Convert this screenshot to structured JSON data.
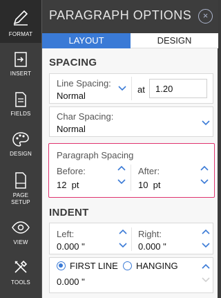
{
  "rail": {
    "items": [
      {
        "label": "FORMAT",
        "icon": "format-pen-icon",
        "active": true
      },
      {
        "label": "INSERT",
        "icon": "insert-icon"
      },
      {
        "label": "FIELDS",
        "icon": "fields-icon"
      },
      {
        "label": "DESIGN",
        "icon": "palette-icon"
      },
      {
        "label": "PAGE",
        "label2": "SETUP",
        "icon": "page-setup-icon"
      },
      {
        "label": "VIEW",
        "icon": "eye-icon"
      },
      {
        "label": "TOOLS",
        "icon": "tools-icon"
      }
    ]
  },
  "panel": {
    "title": "PARAGRAPH OPTIONS",
    "close_glyph": "×",
    "tabs": [
      {
        "label": "LAYOUT",
        "active": true
      },
      {
        "label": "DESIGN",
        "active": false
      }
    ]
  },
  "spacing": {
    "title": "SPACING",
    "line_spacing_label": "Line Spacing:",
    "line_spacing_value": "Normal",
    "at_label": "at",
    "at_value": "1.20",
    "char_spacing_label": "Char Spacing:",
    "char_spacing_value": "Normal",
    "paragraph_spacing_label": "Paragraph Spacing",
    "before_label": "Before:",
    "before_value": "12  pt",
    "after_label": "After:",
    "after_value": "10  pt"
  },
  "indent": {
    "title": "INDENT",
    "left_label": "Left:",
    "left_value": "0.000 \"",
    "right_label": "Right:",
    "right_value": "0.000 \"",
    "first_line_label": "FIRST LINE",
    "hanging_label": "HANGING",
    "selected": "FIRST LINE",
    "first_line_value": "0.000 \""
  },
  "colors": {
    "accent": "#3a7ad6",
    "highlight": "#e0336f",
    "rail_bg": "#3d3d3d"
  }
}
